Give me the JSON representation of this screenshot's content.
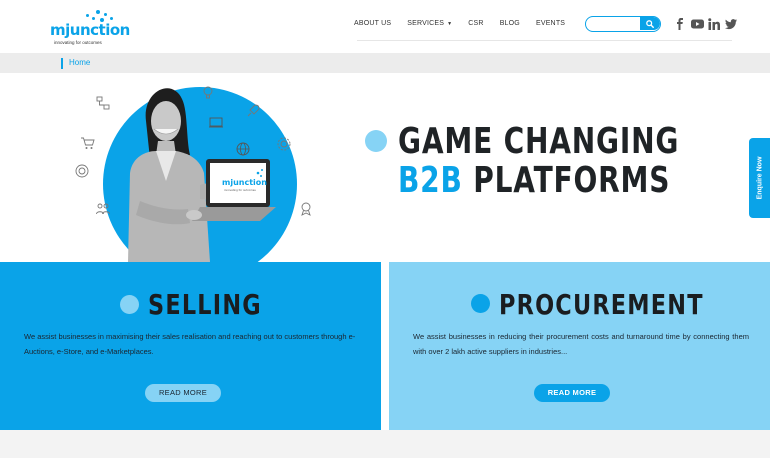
{
  "brand": {
    "logo_text": "mjunction",
    "tagline": "innovating for outcomes"
  },
  "nav": {
    "items": [
      {
        "label": "ABOUT US",
        "has_dropdown": false
      },
      {
        "label": "SERVICES",
        "has_dropdown": true
      },
      {
        "label": "CSR",
        "has_dropdown": false
      },
      {
        "label": "BLOG",
        "has_dropdown": false
      },
      {
        "label": "EVENTS",
        "has_dropdown": false
      }
    ]
  },
  "search": {
    "placeholder": "",
    "value": ""
  },
  "social": [
    "facebook-icon",
    "youtube-icon",
    "linkedin-icon",
    "twitter-icon"
  ],
  "breadcrumb": {
    "home": "Home"
  },
  "hero": {
    "line1": "GAME CHANGING",
    "line2_accent": "B2B",
    "line2_rest": " PLATFORMS"
  },
  "enquire": {
    "label": "Enquire Now"
  },
  "selling": {
    "title": "SELLING",
    "text": "We assist businesses in maximising their sales realisation and reaching out to customers through e-Auctions, e-Store, and e-Marketplaces.",
    "button": "READ MORE"
  },
  "procurement": {
    "title": "PROCUREMENT",
    "text": "We assist businesses in reducing their procurement costs and turnaround time by connecting them with over 2 lakh active suppliers in industries...",
    "button": "READ MORE"
  },
  "colors": {
    "accent": "#0aa3e8",
    "accent_light": "#86d3f5",
    "dark_text": "#1f2326"
  }
}
